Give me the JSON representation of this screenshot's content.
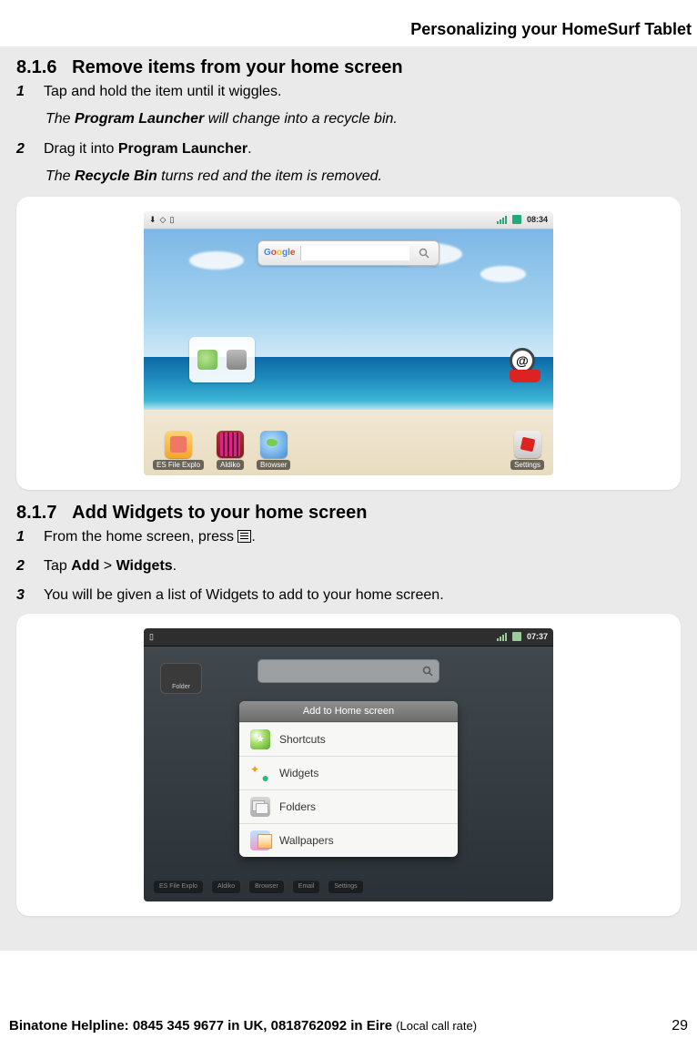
{
  "header": {
    "chapter_title": "Personalizing your HomeSurf Tablet"
  },
  "section_816": {
    "number": "8.1.6",
    "title": "Remove items from your home screen",
    "steps": [
      {
        "num": "1",
        "text": "Tap and hold the item until it wiggles."
      },
      {
        "num": "2",
        "text_pre": "Drag it into ",
        "bold": "Program Launcher",
        "text_post": "."
      }
    ],
    "note1_pre": "The ",
    "note1_bi": "Program Launcher",
    "note1_post": " will change into a recycle bin.",
    "note2_pre": "The ",
    "note2_bi": "Recycle Bin",
    "note2_post": " turns red and the item is removed."
  },
  "screenshot1": {
    "time": "08:34",
    "search_brand": "Google",
    "dock": [
      {
        "label": "ES File Explo"
      },
      {
        "label": "Aldiko"
      },
      {
        "label": "Browser"
      }
    ],
    "dock_right": {
      "label": "Settings"
    },
    "email_label": "Email"
  },
  "section_817": {
    "number": "8.1.7",
    "title": "Add Widgets to your home screen",
    "steps": [
      {
        "num": "1",
        "text_pre": "From the home screen, press ",
        "text_post": "."
      },
      {
        "num": "2",
        "text_pre": "Tap ",
        "b1": "Add",
        "sep": " > ",
        "b2": "Widgets",
        "text_post": "."
      },
      {
        "num": "3",
        "text": "You will be given a list of Widgets to add to your home screen."
      }
    ]
  },
  "screenshot2": {
    "time": "07:37",
    "folder_label": "Folder",
    "panel_title": "Add to Home screen",
    "options": [
      "Shortcuts",
      "Widgets",
      "Folders",
      "Wallpapers"
    ],
    "dock": [
      "ES File Explo",
      "Aldiko",
      "Browser",
      "Email",
      "Settings"
    ]
  },
  "footer": {
    "helpline": "Binatone Helpline: 0845 345 9677 in UK, 0818762092 in Eire ",
    "rate": "(Local call rate)",
    "page": "29"
  }
}
